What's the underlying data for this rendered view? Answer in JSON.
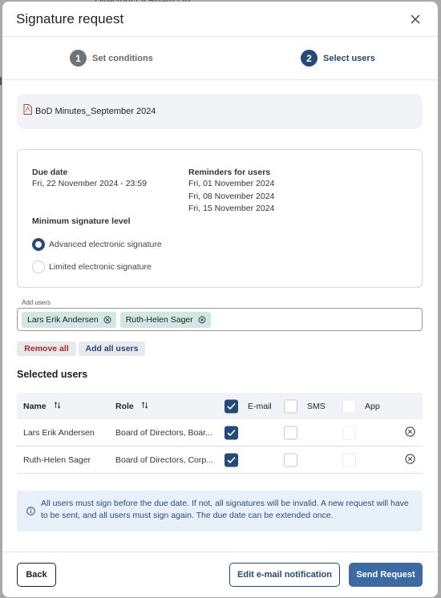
{
  "background": {
    "partial_text": "Directory Of Board Ltd"
  },
  "dialog": {
    "title": "Signature request"
  },
  "steps": [
    {
      "number": "1",
      "label": "Set conditions"
    },
    {
      "number": "2",
      "label": "Select users"
    }
  ],
  "document": {
    "name": "BoD Minutes_September 2024"
  },
  "conditions": {
    "due_date_label": "Due date",
    "due_date_value": "Fri, 22 November 2024 - 23:59",
    "reminders_label": "Reminders for users",
    "reminders": [
      "Fri, 01 November 2024",
      "Fri, 08 November 2024",
      "Fri, 15 November 2024"
    ],
    "min_level_label": "Minimum signature level",
    "options": [
      {
        "label": "Advanced electronic signature",
        "selected": true
      },
      {
        "label": "Limited electronic signature",
        "selected": false
      }
    ]
  },
  "add_users": {
    "label": "Add users",
    "chips": [
      "Lars Erik Andersen",
      "Ruth-Helen Sager"
    ]
  },
  "actions": {
    "remove_all": "Remove all",
    "add_all": "Add all users"
  },
  "selected_users": {
    "title": "Selected users",
    "columns": {
      "name": "Name",
      "role": "Role",
      "email": "E-mail",
      "sms": "SMS",
      "app": "App"
    },
    "header_checks": {
      "email": true,
      "sms": false,
      "app": false
    },
    "rows": [
      {
        "name": "Lars Erik Andersen",
        "role": "Board of Directors, Boar...",
        "email": true,
        "sms": false,
        "app": false
      },
      {
        "name": "Ruth-Helen Sager",
        "role": "Board of Directors, Corp...",
        "email": true,
        "sms": false,
        "app": false
      }
    ]
  },
  "info": {
    "text": "All users must sign before the due date. If not, all signatures will be invalid. A new request will have to be sent, and all users must sign again. The due date can be extended once."
  },
  "footer": {
    "back": "Back",
    "edit_notification": "Edit e-mail notification",
    "send": "Send Request"
  },
  "colors": {
    "primary": "#234a78",
    "danger": "#a92a22",
    "chip": "#cfe9e2",
    "info_bg": "#e8f0fa"
  }
}
